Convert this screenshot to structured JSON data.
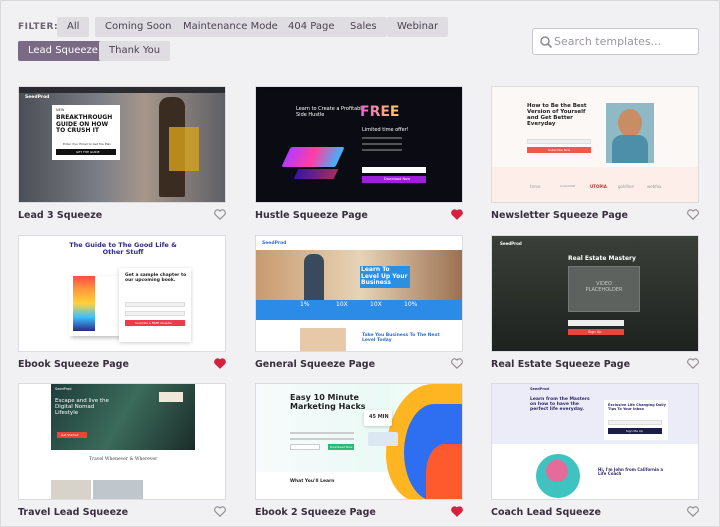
{
  "filter": {
    "label": "FILTER:",
    "chips": [
      "All",
      "Coming Soon",
      "Maintenance Mode",
      "404 Page",
      "Sales",
      "Webinar",
      "Lead Squeeze",
      "Thank You"
    ],
    "active": "Lead Squeeze"
  },
  "search": {
    "placeholder": "Search templates..."
  },
  "colors": {
    "accent": "#7a6a86",
    "heart_active": "#d5203f",
    "heart_inactive": "#8f8a93"
  },
  "cards": [
    {
      "title": "Lead 3 Squeeze",
      "favorited": false,
      "thumb": {
        "logo": "SeedProd",
        "tag": "NEW",
        "headline": "BREAKTHROUGH GUIDE ON HOW TO CRUSH IT",
        "sub": "Enter Your Email to Get the Plan",
        "btn": "GET THE GUIDE"
      }
    },
    {
      "title": "Hustle Squeeze Page",
      "favorited": true,
      "thumb": {
        "headline": "Learn to Create a Profitable Side Hustle",
        "big": "FREE",
        "sub": "Limited time offer!",
        "btn": "Download Now"
      }
    },
    {
      "title": "Newsletter Squeeze Page",
      "favorited": false,
      "thumb": {
        "headline": "How to Be the Best Version of Yourself and Get Better Everyday",
        "btn": "Subscribe Now",
        "logos": [
          "trevo",
          "GOLDLINE",
          "UTOPIA",
          "goldline",
          "webfox"
        ]
      }
    },
    {
      "title": "Ebook Squeeze Page",
      "favorited": true,
      "thumb": {
        "headline": "The Guide to The Good Life & Other Stuff",
        "form_title": "Get a sample chapter to our upcoming book.",
        "btn": "Send Me a FREE Chapter"
      }
    },
    {
      "title": "General Squeeze Page",
      "favorited": false,
      "thumb": {
        "logo": "SeedProd",
        "headline": "Learn To Level Up Your Business",
        "stats": [
          "1%",
          "10X",
          "10X",
          "10%"
        ],
        "sub": "Take You Business To The Next Level Today"
      }
    },
    {
      "title": "Real Estate Squeeze Page",
      "favorited": false,
      "thumb": {
        "logo": "SeedProd",
        "headline": "Real Estate Mastery",
        "placeholder": "VIDEO PLACEHOLDER",
        "btn": "Sign Up"
      }
    },
    {
      "title": "Travel Lead Squeeze",
      "favorited": false,
      "thumb": {
        "logo": "SeedProd",
        "headline": "Escape and live the Digital Nomad Lifestyle",
        "btn": "Get Started",
        "sub": "Travel Whenever & Wherever"
      }
    },
    {
      "title": "Ebook 2 Squeeze Page",
      "favorited": true,
      "thumb": {
        "headline": "Easy 10 Minute Marketing Hacks",
        "badge": "45 MIN",
        "btn": "Download Now",
        "sub": "What You'll Learn"
      }
    },
    {
      "title": "Coach Lead Squeeze",
      "favorited": false,
      "thumb": {
        "logo": "SeedProd",
        "headline": "Learn from the Masters on how to have the perfect life everyday.",
        "form_title": "Exclusive Life Changing Daily Tips To Your Inbox",
        "btn": "Sign Me Up",
        "sub": "Hi, I'm John from California a Life Coach"
      }
    }
  ]
}
